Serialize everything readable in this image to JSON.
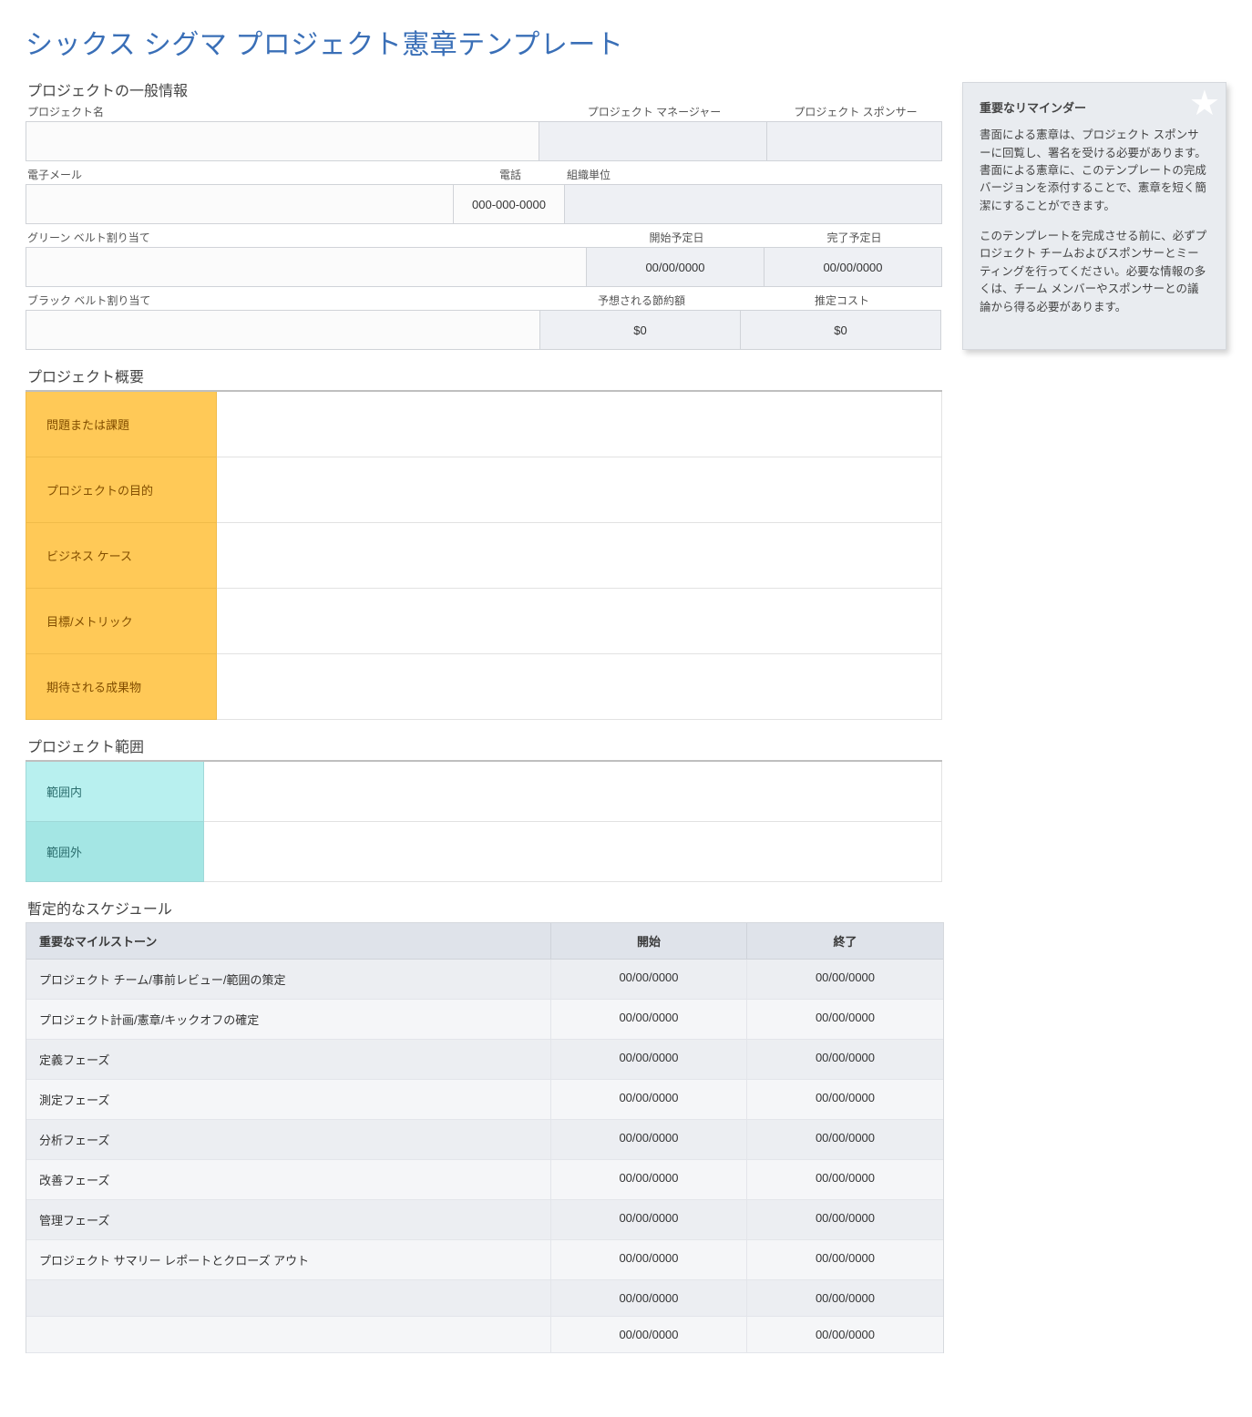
{
  "title": "シックス シグマ プロジェクト憲章テンプレート",
  "section": {
    "general": "プロジェクトの一般情報",
    "overview": "プロジェクト概要",
    "scope": "プロジェクト範囲",
    "schedule": "暫定的なスケジュール"
  },
  "gi_labels": {
    "name": "プロジェクト名",
    "mgr": "プロジェクト マネージャー",
    "spn": "プロジェクト スポンサー",
    "mail": "電子メール",
    "tel": "電話",
    "org": "組織単位",
    "green": "グリーン ベルト割り当て",
    "start": "開始予定日",
    "end": "完了予定日",
    "black": "ブラック ベルト割り当て",
    "save": "予想される節約額",
    "cost": "推定コスト"
  },
  "gi_values": {
    "name": "",
    "mgr": "",
    "spn": "",
    "mail": "",
    "tel": "000-000-0000",
    "org": "",
    "green": "",
    "start": "00/00/0000",
    "end": "00/00/0000",
    "black": "",
    "save": "$0",
    "cost": "$0"
  },
  "overview": [
    "問題または課題",
    "プロジェクトの目的",
    "ビジネス ケース",
    "目標/メトリック",
    "期待される成果物"
  ],
  "scope": [
    "範囲内",
    "範囲外"
  ],
  "sched_hd": {
    "m": "重要なマイルストーン",
    "s": "開始",
    "e": "終了"
  },
  "sched": [
    {
      "m": "プロジェクト チーム/事前レビュー/範囲の策定",
      "s": "00/00/0000",
      "e": "00/00/0000"
    },
    {
      "m": "プロジェクト計画/憲章/キックオフの確定",
      "s": "00/00/0000",
      "e": "00/00/0000"
    },
    {
      "m": "定義フェーズ",
      "s": "00/00/0000",
      "e": "00/00/0000"
    },
    {
      "m": "測定フェーズ",
      "s": "00/00/0000",
      "e": "00/00/0000"
    },
    {
      "m": "分析フェーズ",
      "s": "00/00/0000",
      "e": "00/00/0000"
    },
    {
      "m": "改善フェーズ",
      "s": "00/00/0000",
      "e": "00/00/0000"
    },
    {
      "m": "管理フェーズ",
      "s": "00/00/0000",
      "e": "00/00/0000"
    },
    {
      "m": "プロジェクト サマリー レポートとクローズ アウト",
      "s": "00/00/0000",
      "e": "00/00/0000"
    },
    {
      "m": "",
      "s": "00/00/0000",
      "e": "00/00/0000"
    },
    {
      "m": "",
      "s": "00/00/0000",
      "e": "00/00/0000"
    }
  ],
  "reminder": {
    "title": "重要なリマインダー",
    "p1": "書面による憲章は、プロジェクト スポンサーに回覧し、署名を受ける必要があります。書面による憲章に、このテンプレートの完成バージョンを添付することで、憲章を短く簡潔にすることができます。",
    "p2": "このテンプレートを完成させる前に、必ずプロジェクト チームおよびスポンサーとミーティングを行ってください。必要な情報の多くは、チーム メンバーやスポンサーとの議論から得る必要があります。"
  }
}
